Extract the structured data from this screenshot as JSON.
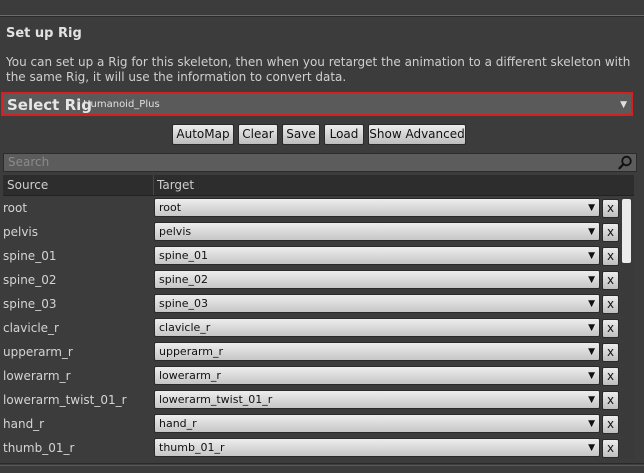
{
  "section_title": "Set up Rig",
  "description": "You can set up a Rig for this skeleton, then when you retarget the animation to a different skeleton with the same Rig, it will use the information to convert data.",
  "select_rig": {
    "label": "Select Rig",
    "value": "Humanoid_Plus",
    "arrow": "▼"
  },
  "buttons": {
    "automap": "AutoMap",
    "clear": "Clear",
    "save": "Save",
    "load": "Load",
    "show_advanced": "Show Advanced"
  },
  "search": {
    "placeholder": "Search"
  },
  "table": {
    "source_header": "Source",
    "target_header": "Target",
    "clear_label": "x",
    "dropdown_arrow": "▼",
    "rows": [
      {
        "source": "root",
        "target": "root"
      },
      {
        "source": "pelvis",
        "target": "pelvis"
      },
      {
        "source": "spine_01",
        "target": "spine_01"
      },
      {
        "source": "spine_02",
        "target": "spine_02"
      },
      {
        "source": "spine_03",
        "target": "spine_03"
      },
      {
        "source": "clavicle_r",
        "target": "clavicle_r"
      },
      {
        "source": "upperarm_r",
        "target": "upperarm_r"
      },
      {
        "source": "lowerarm_r",
        "target": "lowerarm_r"
      },
      {
        "source": "lowerarm_twist_01_r",
        "target": "lowerarm_twist_01_r"
      },
      {
        "source": "hand_r",
        "target": "hand_r"
      },
      {
        "source": "thumb_01_r",
        "target": "thumb_01_r"
      }
    ]
  },
  "colors": {
    "highlight_border": "#d42020",
    "panel_bg": "#3c3c3c"
  }
}
